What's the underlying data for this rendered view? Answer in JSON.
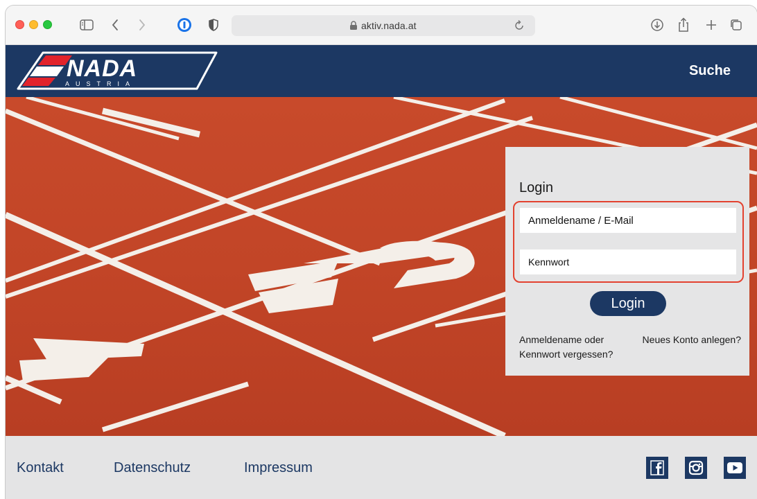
{
  "browser": {
    "url": "aktiv.nada.at",
    "toolbar_icons": [
      "sidebar-icon",
      "back-icon",
      "forward-icon",
      "password-manager-icon",
      "shield-icon",
      "lock-icon",
      "reload-icon",
      "download-icon",
      "share-icon",
      "plus-icon",
      "tabs-icon"
    ]
  },
  "header": {
    "logo_text": "NADA",
    "logo_subtext": "AUSTRIA",
    "search_label": "Suche"
  },
  "login": {
    "title": "Login",
    "username_placeholder": "Anmeldename / E-Mail",
    "password_placeholder": "Kennwort",
    "button_label": "Login",
    "forgot_link": "Anmeldename oder Kennwort vergessen?",
    "register_link": "Neues Konto anlegen?"
  },
  "footer": {
    "links": [
      "Kontakt",
      "Datenschutz",
      "Impressum"
    ],
    "social": [
      "facebook-icon",
      "instagram-icon",
      "youtube-icon"
    ]
  },
  "colors": {
    "brand_navy": "#1c3863",
    "track_red": "#c8492a",
    "highlight_border": "#e3412f"
  }
}
